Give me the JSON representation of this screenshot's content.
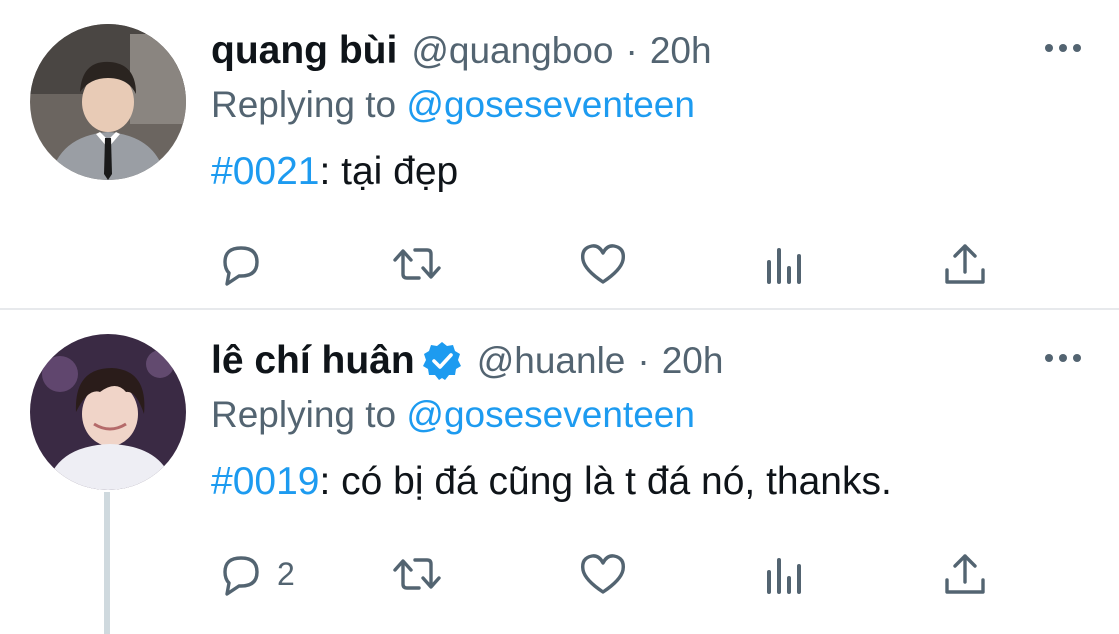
{
  "tweets": [
    {
      "name": "quang bùi",
      "handle": "@quangboo",
      "separator": "·",
      "time": "20h",
      "verified": false,
      "replying_prefix": "Replying to",
      "replying_to": "@goseseventeen",
      "hashtag": "#0021",
      "text": ": tại đẹp",
      "reply_count": ""
    },
    {
      "name": "lê chí huân",
      "handle": "@huanle",
      "separator": "·",
      "time": "20h",
      "verified": true,
      "replying_prefix": "Replying to",
      "replying_to": "@goseseventeen",
      "hashtag": "#0019",
      "text": ": có bị đá cũng là t đá nó, thanks.",
      "reply_count": "2"
    }
  ],
  "icons": {
    "more": "more-horizontal-icon",
    "reply": "reply-icon",
    "retweet": "retweet-icon",
    "like": "heart-icon",
    "views": "views-icon",
    "share": "share-icon",
    "verified": "verified-badge-icon"
  },
  "colors": {
    "link": "#1d9bf0",
    "secondary_text": "#536471",
    "primary_text": "#0f1419",
    "divider": "#e7e9ec"
  }
}
